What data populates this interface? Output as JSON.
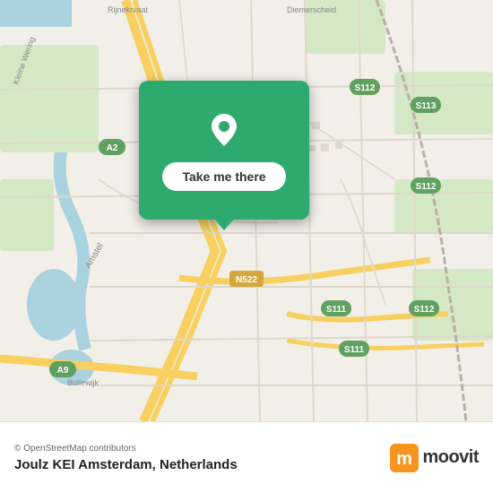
{
  "map": {
    "alt": "OpenStreetMap of Amsterdam area"
  },
  "popup": {
    "button_label": "Take me there",
    "pin_color": "#ffffff"
  },
  "footer": {
    "credit": "© OpenStreetMap contributors",
    "location_title": "Joulz KEI Amsterdam, Netherlands",
    "moovit_label": "moovit"
  }
}
